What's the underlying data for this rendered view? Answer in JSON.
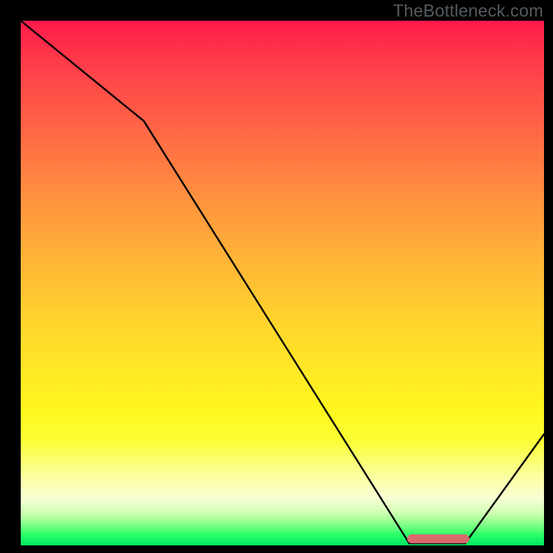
{
  "watermark": "TheBottleneck.com",
  "chart_data": {
    "type": "line",
    "title": "",
    "xlabel": "",
    "ylabel": "",
    "xlim": [
      0,
      1
    ],
    "ylim": [
      0,
      1
    ],
    "grid": false,
    "legend": false,
    "gradient_stops": [
      {
        "pos": 0.0,
        "color": "#ff1a4b"
      },
      {
        "pos": 0.08,
        "color": "#ff3c4a"
      },
      {
        "pos": 0.22,
        "color": "#ff6a45"
      },
      {
        "pos": 0.33,
        "color": "#ff8f3f"
      },
      {
        "pos": 0.45,
        "color": "#ffb337"
      },
      {
        "pos": 0.56,
        "color": "#ffd12e"
      },
      {
        "pos": 0.66,
        "color": "#ffe726"
      },
      {
        "pos": 0.74,
        "color": "#fff61e"
      },
      {
        "pos": 0.8,
        "color": "#fbff34"
      },
      {
        "pos": 0.88,
        "color": "#fbffb0"
      },
      {
        "pos": 0.91,
        "color": "#f7ffd4"
      },
      {
        "pos": 0.935,
        "color": "#d6ffb8"
      },
      {
        "pos": 0.95,
        "color": "#a8ff9a"
      },
      {
        "pos": 0.965,
        "color": "#6fff80"
      },
      {
        "pos": 0.98,
        "color": "#2bff67"
      },
      {
        "pos": 1.0,
        "color": "#00e765"
      }
    ],
    "series": [
      {
        "name": "bottleneck-curve",
        "color": "#000000",
        "x": [
          0.0,
          0.235,
          0.742,
          0.85,
          1.0
        ],
        "y": [
          1.0,
          0.81,
          0.0,
          0.0,
          0.21
        ]
      }
    ],
    "annotations": [
      {
        "name": "optimal-range-marker",
        "type": "rounded-bar",
        "color": "#d96b6e",
        "x_start": 0.739,
        "x_end": 0.858,
        "y": 0.012
      }
    ]
  }
}
